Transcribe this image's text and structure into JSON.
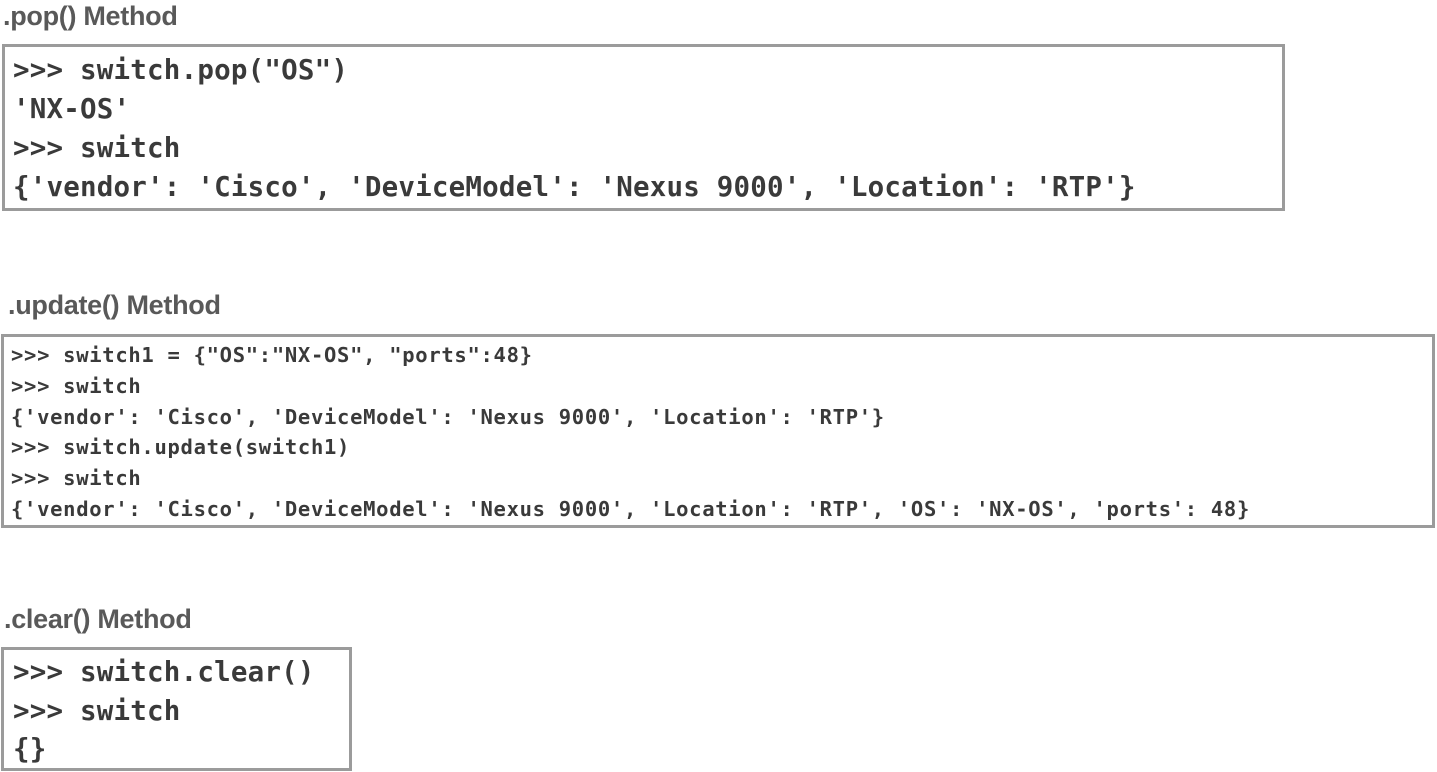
{
  "pop_section": {
    "heading": ".pop() Method",
    "lines": [
      ">>> switch.pop(\"OS\")",
      "'NX-OS'",
      ">>> switch",
      "{'vendor': 'Cisco', 'DeviceModel': 'Nexus 9000', 'Location': 'RTP'}"
    ]
  },
  "update_section": {
    "heading": ".update() Method",
    "lines": [
      ">>> switch1 = {\"OS\":\"NX-OS\", \"ports\":48}",
      ">>> switch",
      "{'vendor': 'Cisco', 'DeviceModel': 'Nexus 9000', 'Location': 'RTP'}",
      ">>> switch.update(switch1)",
      ">>> switch",
      "{'vendor': 'Cisco', 'DeviceModel': 'Nexus 9000', 'Location': 'RTP', 'OS': 'NX-OS', 'ports': 48}"
    ]
  },
  "clear_section": {
    "heading": ".clear() Method",
    "lines": [
      ">>> switch.clear()",
      ">>> switch",
      "{}"
    ]
  }
}
